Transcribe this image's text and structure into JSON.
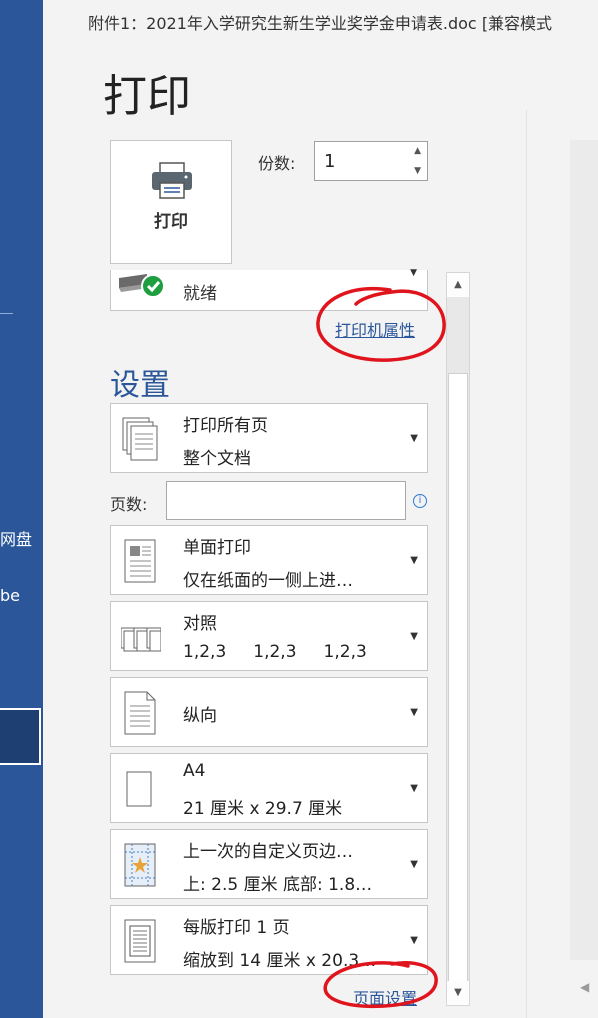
{
  "window": {
    "doc_title": "附件1：2021年入学研究生新生学业奖学金申请表.doc [兼容模式"
  },
  "backstage": {
    "left_labels": [
      "网盘",
      "be"
    ]
  },
  "page": {
    "title": "打印"
  },
  "print_button": {
    "label": "打印"
  },
  "copies": {
    "label": "份数:",
    "value": "1"
  },
  "printer": {
    "status": "就绪",
    "properties_link": "打印机属性"
  },
  "settings": {
    "heading": "设置",
    "print_range": {
      "line1": "打印所有页",
      "line2": "整个文档"
    },
    "pages": {
      "label": "页数:",
      "value": "",
      "info": "i"
    },
    "sides": {
      "line1": "单面打印",
      "line2": "仅在纸面的一侧上进…"
    },
    "collate": {
      "line1": "对照",
      "line2": "1,2,3     1,2,3     1,2,3"
    },
    "orientation": {
      "label": "纵向"
    },
    "paper": {
      "line1": "A4",
      "line2": "21 厘米 x 29.7 厘米"
    },
    "margins": {
      "line1": "上一次的自定义页边…",
      "line2": "上: 2.5 厘米 底部: 1.8…"
    },
    "pages_per_sheet": {
      "line1": "每版打印 1 页",
      "line2": "缩放到 14 厘米 x 20.3…"
    },
    "page_setup_link": "页面设置"
  },
  "icons": {
    "printer": "printer-icon",
    "ready_check": "check-circle-icon",
    "dropdown": "chevron-down-icon",
    "info": "info-icon"
  },
  "colors": {
    "backstage": "#2b579a",
    "link": "#2b579a",
    "annotation": "#e0141c",
    "ready_check": "#1e9e3e"
  }
}
